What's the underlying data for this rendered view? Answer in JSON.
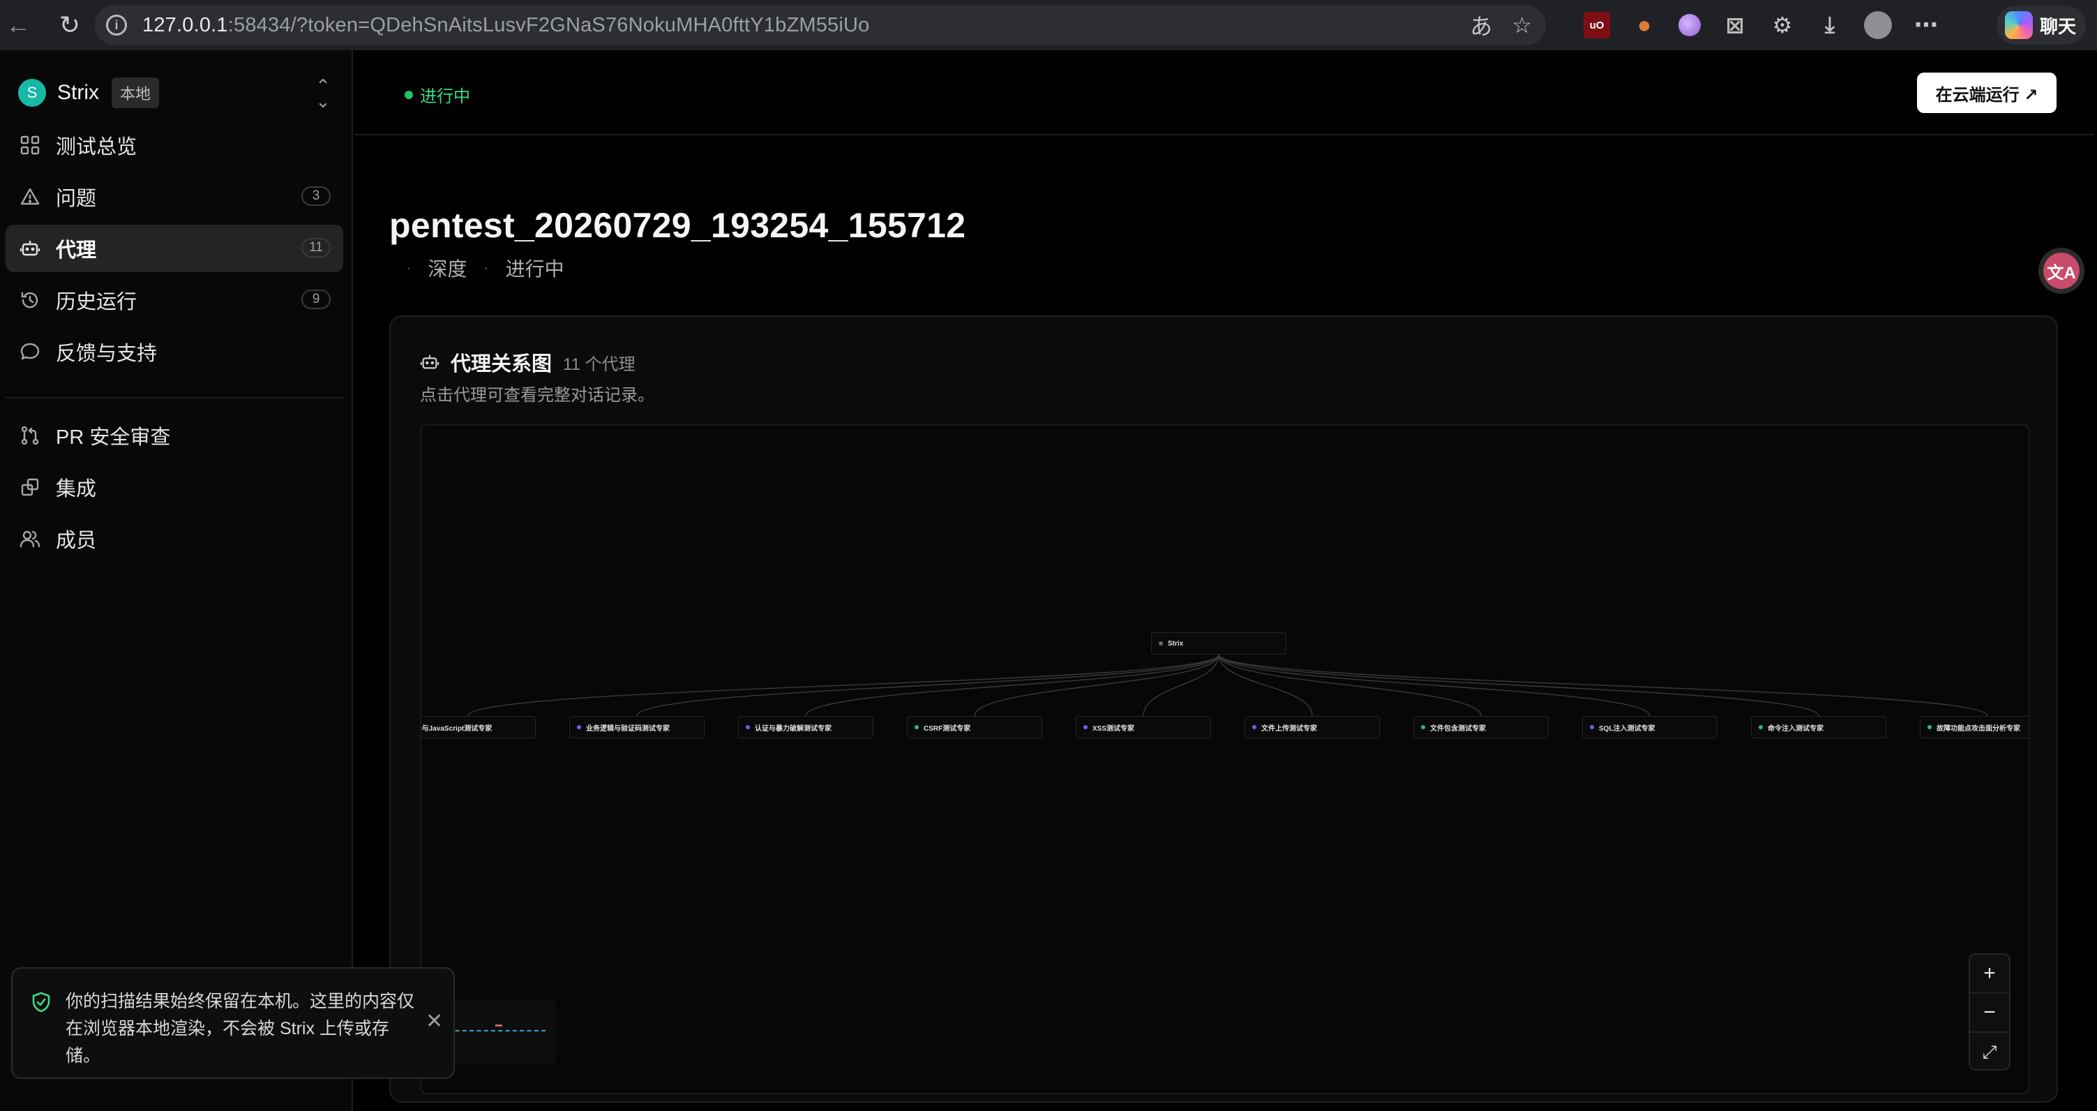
{
  "browser": {
    "url_host": "127.0.0.1",
    "url_rest": ":58434/?token=QDehSnAitsLusvF2GNaS76NokuMHA0fttY1bZM55iUo",
    "chat_label": "聊天",
    "extensions": [
      "ublock-origin-icon",
      "cookie-icon",
      "purple-circle-icon",
      "x-extension-icon",
      "extensions-puzzle-icon",
      "download-icon",
      "profile-avatar",
      "more-menu-icon"
    ]
  },
  "sidebar": {
    "brand_initial": "S",
    "brand_name": "Strix",
    "env_badge": "本地",
    "items": [
      {
        "label": "测试总览",
        "icon": "grid-icon"
      },
      {
        "label": "问题",
        "icon": "warning-icon",
        "count": "3"
      },
      {
        "label": "代理",
        "icon": "robot-icon",
        "count": "11",
        "active": true
      },
      {
        "label": "历史运行",
        "icon": "history-icon",
        "count": "9"
      },
      {
        "label": "反馈与支持",
        "icon": "chat-bubble-icon"
      },
      {
        "label": "PR 安全审查",
        "icon": "git-pull-request-icon"
      },
      {
        "label": "集成",
        "icon": "integrations-icon"
      },
      {
        "label": "成员",
        "icon": "members-icon"
      }
    ],
    "toast": {
      "text": "你的扫描结果始终保留在本机。这里的内容仅在浏览器本地渲染，不会被 Strix 上传或存储。"
    }
  },
  "main": {
    "status": "进行中",
    "cloud_button": "在云端运行 ↗",
    "title": "pentest_20260729_193254_155712",
    "meta": [
      "深度",
      "进行中"
    ],
    "translate_fab": "文A",
    "card": {
      "title": "代理关系图",
      "count": "11 个代理",
      "subtitle": "点击代理可查看完整对话记录。"
    },
    "graph": {
      "root": {
        "label": "Strix",
        "dot_color": "#6b6b6b"
      },
      "children": [
        {
          "label": "P与JavaScript测试专家",
          "dot_color": "#22c55e"
        },
        {
          "label": "业务逻辑与验证码测试专家",
          "dot_color": "#6366f1"
        },
        {
          "label": "认证与暴力破解测试专家",
          "dot_color": "#6366f1"
        },
        {
          "label": "CSRF测试专家",
          "dot_color": "#22c55e"
        },
        {
          "label": "XSS测试专家",
          "dot_color": "#6366f1"
        },
        {
          "label": "文件上传测试专家",
          "dot_color": "#6366f1"
        },
        {
          "label": "文件包含测试专家",
          "dot_color": "#22c55e"
        },
        {
          "label": "SQL注入测试专家",
          "dot_color": "#6366f1"
        },
        {
          "label": "命令注入测试专家",
          "dot_color": "#22c55e"
        },
        {
          "label": "故障功能点攻击面分析专家",
          "dot_color": "#22c55e"
        }
      ],
      "zoom": [
        "+",
        "−",
        "⤢"
      ]
    }
  }
}
